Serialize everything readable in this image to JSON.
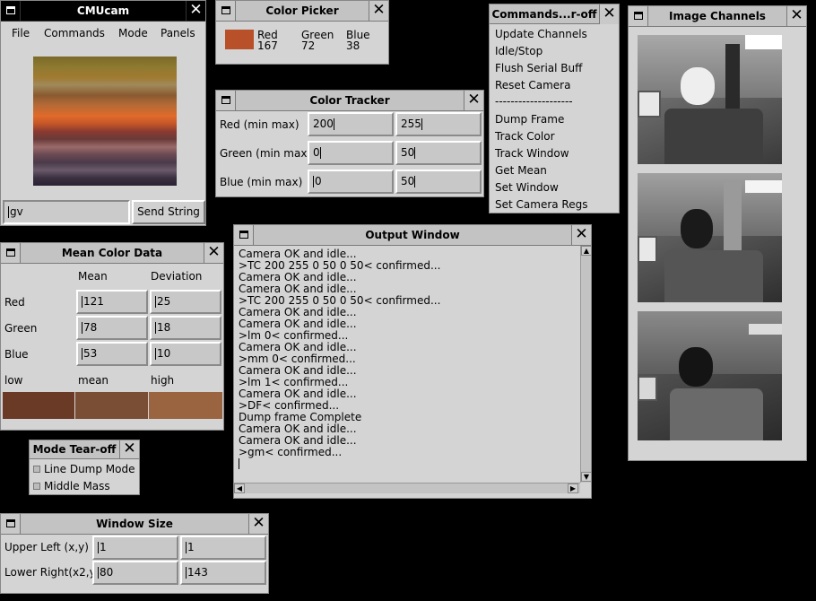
{
  "cmucam": {
    "title": "CMUcam",
    "menu": [
      "File",
      "Commands",
      "Mode",
      "Panels"
    ],
    "send_value": "gv",
    "send_button": "Send String"
  },
  "color_picker": {
    "title": "Color Picker",
    "swatch_color": "#b8502a",
    "red_label": "Red",
    "red_value": "167",
    "green_label": "Green",
    "green_value": "72",
    "blue_label": "Blue",
    "blue_value": "38"
  },
  "commands_menu": {
    "title": "Commands...r-off",
    "items_top": [
      "Update Channels",
      "Idle/Stop",
      "Flush Serial Buff",
      "Reset Camera"
    ],
    "separator": "--------------------",
    "items_bottom": [
      "Dump Frame",
      "Track Color",
      "Track Window",
      "Get Mean",
      "Set Window",
      "Set Camera Regs"
    ]
  },
  "image_channels": {
    "title": "Image Channels"
  },
  "color_tracker": {
    "title": "Color Tracker",
    "rows": [
      {
        "label": "Red (min max)",
        "min": "200",
        "max": "255"
      },
      {
        "label": "Green (min max",
        "min": "0",
        "max": "50"
      },
      {
        "label": "Blue (min max)",
        "min": "0",
        "max": "50"
      }
    ]
  },
  "output_window": {
    "title": "Output Window",
    "lines": [
      "Camera OK and idle...",
      ">TC 200 255 0 50 0 50< confirmed...",
      "Camera OK and idle...",
      "Camera OK and idle...",
      ">TC 200 255 0 50 0 50< confirmed...",
      "Camera OK and idle...",
      "Camera OK and idle...",
      ">lm 0< confirmed...",
      "Camera OK and idle...",
      ">mm 0< confirmed...",
      "Camera OK and idle...",
      ">lm 1< confirmed...",
      "Camera OK and idle...",
      ">DF< confirmed...",
      "Dump frame Complete",
      "Camera OK and idle...",
      "Camera OK and idle...",
      ">gm< confirmed..."
    ]
  },
  "mean_color": {
    "title": "Mean Color Data",
    "col_mean": "Mean",
    "col_dev": "Deviation",
    "rows": [
      {
        "label": "Red",
        "mean": "121",
        "dev": "25"
      },
      {
        "label": "Green",
        "mean": "78",
        "dev": "18"
      },
      {
        "label": "Blue",
        "mean": "53",
        "dev": "10"
      }
    ],
    "low_label": "low",
    "mean_label": "mean",
    "high_label": "high",
    "low_color": "#6a3a26",
    "mean_color_value": "#794e34",
    "high_color": "#9a6440"
  },
  "mode_tearoff": {
    "title": "Mode Tear-off",
    "options": [
      "Line Dump Mode",
      "Middle Mass"
    ]
  },
  "window_size": {
    "title": "Window Size",
    "upper_label": "Upper Left (x,y)",
    "upper_x": "1",
    "upper_y": "1",
    "lower_label": "Lower Right(x2,y",
    "lower_x": "80",
    "lower_y": "143"
  }
}
